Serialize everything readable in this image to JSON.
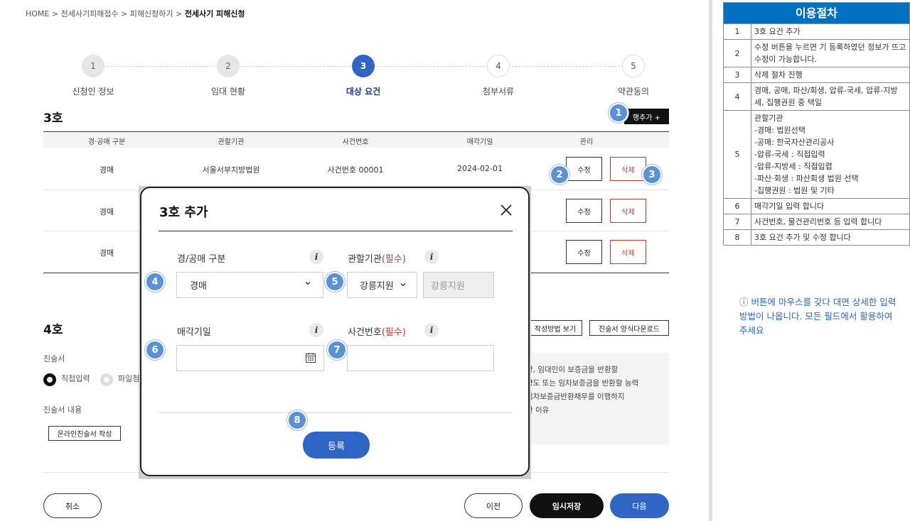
{
  "breadcrumb": {
    "home": "HOME",
    "sep": ">",
    "l1": "전세사기피해접수",
    "l2": "피해신청하기",
    "current": "전세사기 피해신청"
  },
  "steps": [
    {
      "num": "1",
      "label": "신청인 정보"
    },
    {
      "num": "2",
      "label": "임대 현황"
    },
    {
      "num": "3",
      "label": "대상 요건"
    },
    {
      "num": "4",
      "label": "첨부서류"
    },
    {
      "num": "5",
      "label": "약관동의"
    }
  ],
  "section3": {
    "title": "3호",
    "add_row": "행추가 +",
    "headers": [
      "경·공매 구분",
      "관할기관",
      "사건번호",
      "매각기일",
      "관리"
    ],
    "rows": [
      {
        "type": "경매",
        "agency": "서울서부지방법원",
        "case": "사건번호 00001",
        "date": "2024-02-01"
      },
      {
        "type": "경매"
      },
      {
        "type": "경매"
      }
    ],
    "edit": "수정",
    "delete": "삭제"
  },
  "section4": {
    "title": "4호",
    "btn_guide": "작성방법 보기",
    "btn_download": "진술서 양식다운로드",
    "statement_label": "진술서",
    "radio_direct": "직접입력",
    "radio_file": "파일첨",
    "content_label": "진술서 내용",
    "online_btn": "온라인진술서 작성",
    "info_lines": [
      "항, 임대인이 보증금을 반환할",
      "양도 또는 임차보증금을 반환할 능력",
      "임차보증금반환채무를 이행하지",
      "한 이유"
    ]
  },
  "modal": {
    "title": "3호 추가",
    "type_label": "경/공매 구분",
    "type_value": "경매",
    "agency_label": "관할기관",
    "required": "(필수)",
    "agency_select": "강릉지원",
    "agency_display": "강릉지원",
    "date_label": "매각기일",
    "case_label": "사건번호",
    "submit": "등록"
  },
  "badges": [
    "1",
    "2",
    "3",
    "4",
    "5",
    "6",
    "7",
    "8"
  ],
  "footer": {
    "cancel": "취소",
    "prev": "이전",
    "temp_save": "임시저장",
    "next": "다음"
  },
  "procedure": {
    "title": "이용절차",
    "rows": [
      {
        "n": "1",
        "text": "3호 요건 추가"
      },
      {
        "n": "2",
        "text": "수정 버튼을 누르면 기 등록하였던 정보가 뜨고 수정이 가능합니다."
      },
      {
        "n": "3",
        "text": "삭제 절차 진행"
      },
      {
        "n": "4",
        "text": "경매, 공매, 파산/회생, 압류-국세, 압류-지방세, 집행권원 중 택일"
      },
      {
        "n": "5",
        "lines": [
          "관할기관",
          "-경매: 법원선택",
          "-공매: 한국자산관리공사",
          "-압류-국세 : 직접입력",
          "-압류-지방세 : 직접입렵",
          "-파산·회생 : 파산회생 법원 선택",
          "-집행권원 : 법원 및 기타"
        ]
      },
      {
        "n": "6",
        "text": "매각기일 입력 합니다"
      },
      {
        "n": "7",
        "text": "사건번호, 물건관리번호 등 입력 합니다"
      },
      {
        "n": "8",
        "text": "3호 요건 추가 및 수정 합니다"
      }
    ],
    "note": "ⓘ 버튼에 마우스를 갖다 대면 상세한 입력 방법이 나옵니다. 모든 필드에서 활용하여 주세요"
  },
  "colors": {
    "primary": "#2f66c5",
    "danger": "#c0392b",
    "procedure_header": "#0070c0"
  }
}
